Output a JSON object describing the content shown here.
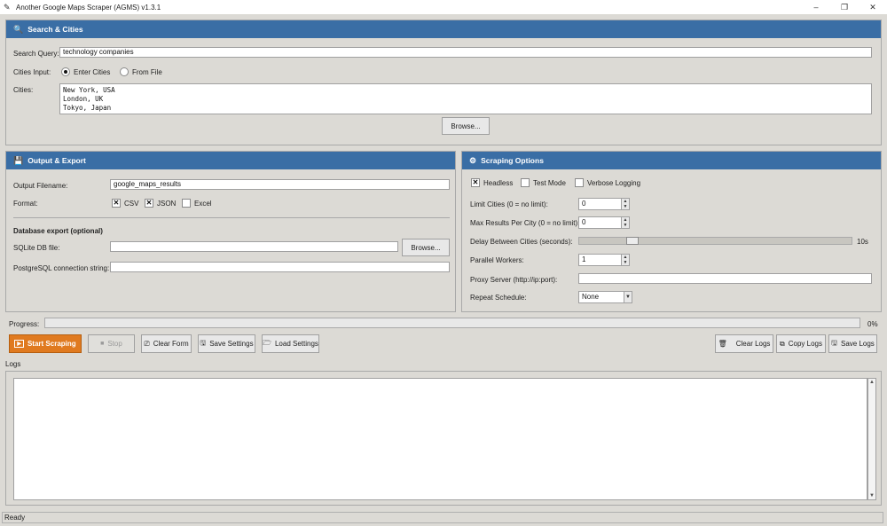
{
  "window": {
    "title": "Another Google Maps Scraper (AGMS) v1.3.1",
    "minimize": "–",
    "maximize": "❐",
    "close": "✕"
  },
  "search": {
    "header": "Search & Cities",
    "query_label": "Search Query:",
    "query_value": "technology companies",
    "cities_input_label": "Cities Input:",
    "option_enter": "Enter Cities",
    "option_file": "From File",
    "selected_option": "Enter Cities",
    "cities_label": "Cities:",
    "cities": [
      "New York, USA",
      "London, UK",
      "Tokyo, Japan"
    ],
    "browse_label": "Browse..."
  },
  "output": {
    "header": "Output & Export",
    "filename_label": "Output Filename:",
    "filename_value": "google_maps_results",
    "format_label": "Format:",
    "formats": [
      {
        "label": "CSV",
        "checked": true
      },
      {
        "label": "JSON",
        "checked": true
      },
      {
        "label": "Excel",
        "checked": false
      }
    ],
    "db_heading": "Database export (optional)",
    "sqlite_label": "SQLite DB file:",
    "sqlite_value": "",
    "sqlite_browse": "Browse...",
    "postgres_label": "PostgreSQL connection string:",
    "postgres_value": ""
  },
  "options": {
    "header": "Scraping Options",
    "headless_label": "Headless",
    "headless_checked": true,
    "test_mode_label": "Test Mode",
    "test_mode_checked": false,
    "verbose_label": "Verbose Logging",
    "verbose_checked": false,
    "limit_cities_label": "Limit Cities (0 = no limit):",
    "limit_cities_value": "0",
    "max_results_label": "Max Results Per City (0 = no limit):",
    "max_results_value": "0",
    "delay_label": "Delay Between Cities (seconds):",
    "delay_value_text": "10s",
    "delay_fraction": 0.18,
    "workers_label": "Parallel Workers:",
    "workers_value": "1",
    "proxy_label": "Proxy Server (http://ip:port):",
    "proxy_value": "",
    "repeat_label": "Repeat Schedule:",
    "repeat_value": "None"
  },
  "progress": {
    "label": "Progress:",
    "percent_text": "0%",
    "fraction": 0
  },
  "toolbar": {
    "start": "Start Scraping",
    "stop": "Stop",
    "clear_form": "Clear Form",
    "save_settings": "Save Settings",
    "load_settings": "Load Settings",
    "clear_logs": "Clear Logs",
    "copy_logs": "Copy Logs",
    "save_logs": "Save Logs"
  },
  "logs": {
    "label": "Logs",
    "content": ""
  },
  "status": {
    "text": "Ready"
  },
  "colors": {
    "header_blue": "#3a6ea5",
    "start_orange": "#e07a1f"
  }
}
